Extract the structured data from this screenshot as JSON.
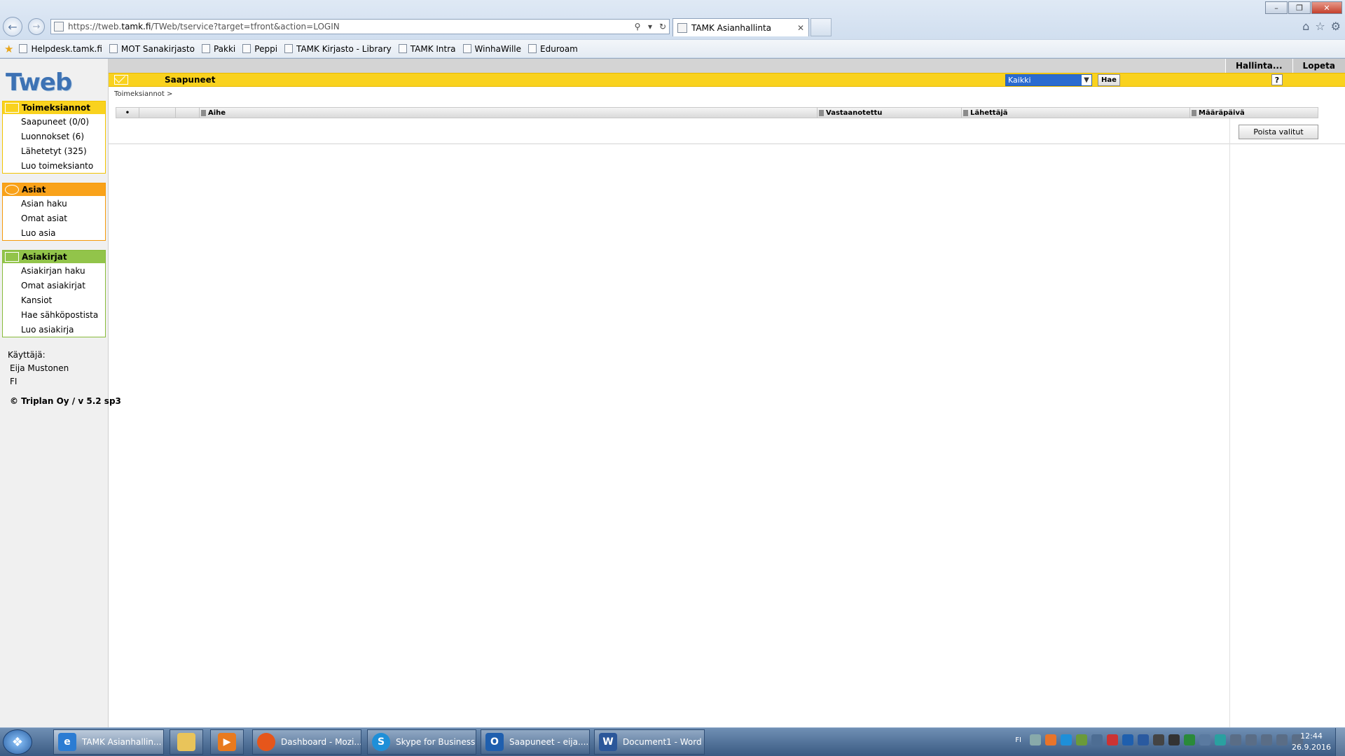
{
  "browser": {
    "url_prefix": "https://tweb.",
    "url_domain": "tamk.fi",
    "url_path": "/TWeb/tservice?target=tfront&action=LOGIN",
    "tab_title": "TAMK Asianhallinta",
    "favorites": [
      "Helpdesk.tamk.fi",
      "MOT Sanakirjasto",
      "Pakki",
      "Peppi",
      "TAMK Kirjasto - Library",
      "TAMK Intra",
      "WinhaWille",
      "Eduroam"
    ]
  },
  "app": {
    "logo_part1": "T",
    "logo_part2": "web",
    "admin_link": "Hallinta...",
    "logout_link": "Lopeta",
    "page_title": "Saapuneet",
    "filter_value": "Kaikki",
    "search_label": "Hae",
    "help_label": "?",
    "breadcrumb": "Toimeksiannot >",
    "delete_label": "Poista valitut"
  },
  "sidebar": {
    "toimeksiannot": {
      "title": "Toimeksiannot",
      "items": [
        "Saapuneet  (0/0)",
        "Luonnokset  (6)",
        "Lähetetyt  (325)",
        "Luo toimeksianto"
      ]
    },
    "asiat": {
      "title": "Asiat",
      "items": [
        "Asian haku",
        "Omat asiat",
        "Luo asia"
      ]
    },
    "asiakirjat": {
      "title": "Asiakirjat",
      "items": [
        "Asiakirjan haku",
        "Omat asiakirjat",
        "Kansiot",
        "Hae sähköpostista",
        "Luo asiakirja"
      ]
    },
    "user_label": "Käyttäjä:",
    "user_name": "Eija Mustonen",
    "user_lang": "FI",
    "copyright": "© Triplan Oy / v 5.2 sp3"
  },
  "grid": {
    "select_marker": "•",
    "columns": [
      "Aihe",
      "Vastaanotettu",
      "Lähettäjä",
      "Määräpäivä"
    ]
  },
  "taskbar": {
    "items": [
      "TAMK Asianhallin...",
      "Dashboard - Mozi...",
      "Skype for Business",
      "Saapuneet - eija....",
      "Document1 - Word"
    ],
    "lang": "FI",
    "time": "12:44",
    "date": "26.9.2016"
  },
  "colors": {
    "toimeksiannot": "#f9d21e",
    "asiat": "#f9a21a",
    "asiakirjat": "#92c44a",
    "filter_select": "#2a6bd0"
  }
}
